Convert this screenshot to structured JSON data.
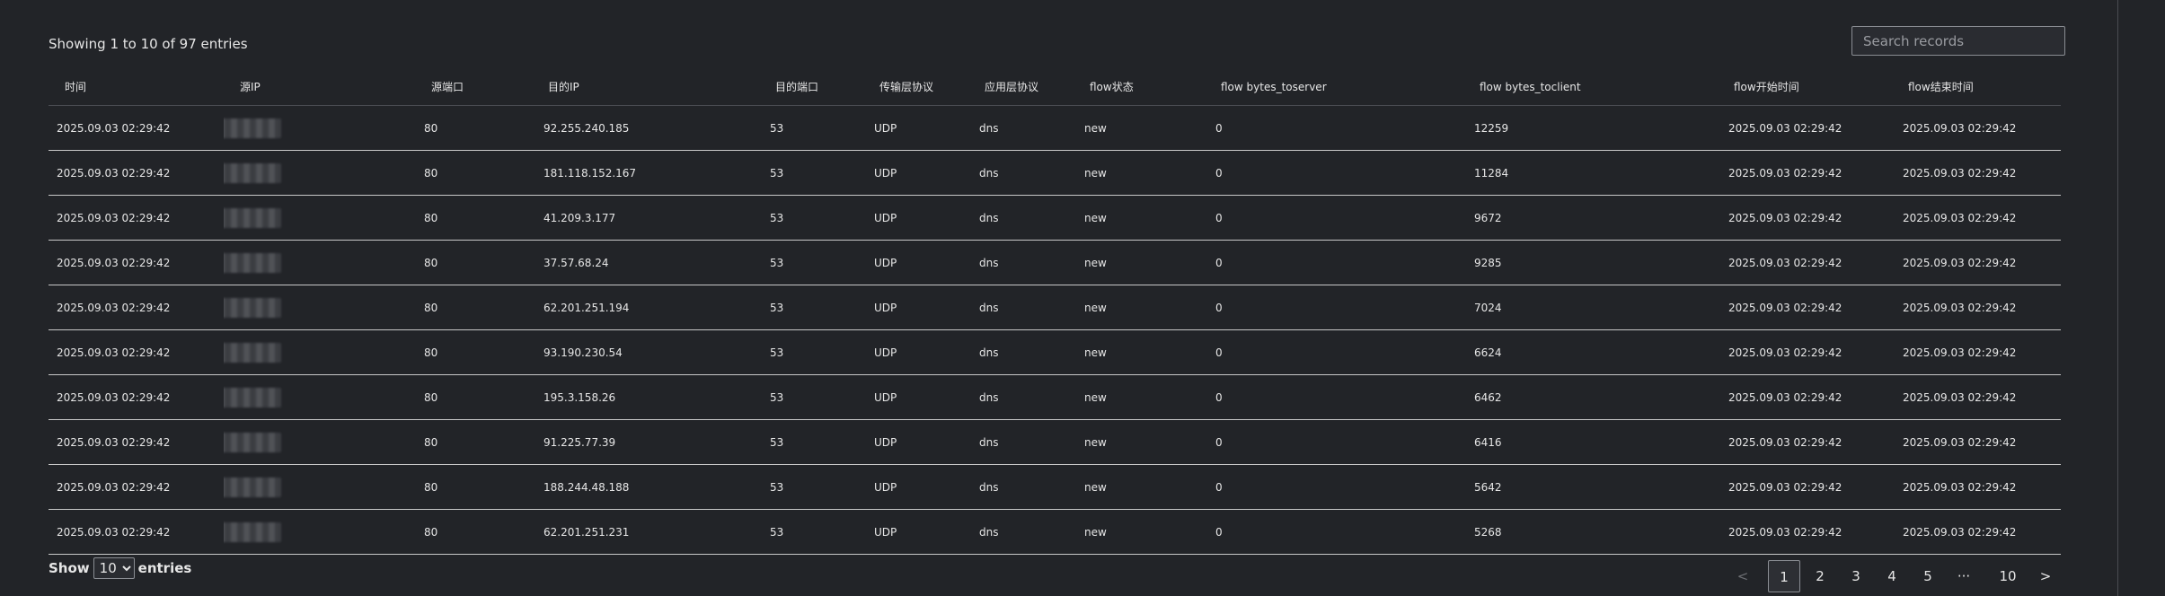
{
  "summary": "Showing 1 to 10 of 97 entries",
  "search": {
    "placeholder": "Search records"
  },
  "table": {
    "columns": [
      "时间",
      "源IP",
      "源端口",
      "目的IP",
      "目的端口",
      "传输层协议",
      "应用层协议",
      "flow状态",
      "flow bytes_toserver",
      "flow bytes_toclient",
      "flow开始时间",
      "flow结束时间"
    ],
    "rows": [
      [
        "2025.09.03 02:29:42",
        "",
        "80",
        "92.255.240.185",
        "53",
        "UDP",
        "dns",
        "new",
        "0",
        "12259",
        "2025.09.03 02:29:42",
        "2025.09.03 02:29:42"
      ],
      [
        "2025.09.03 02:29:42",
        "",
        "80",
        "181.118.152.167",
        "53",
        "UDP",
        "dns",
        "new",
        "0",
        "11284",
        "2025.09.03 02:29:42",
        "2025.09.03 02:29:42"
      ],
      [
        "2025.09.03 02:29:42",
        "",
        "80",
        "41.209.3.177",
        "53",
        "UDP",
        "dns",
        "new",
        "0",
        "9672",
        "2025.09.03 02:29:42",
        "2025.09.03 02:29:42"
      ],
      [
        "2025.09.03 02:29:42",
        "",
        "80",
        "37.57.68.24",
        "53",
        "UDP",
        "dns",
        "new",
        "0",
        "9285",
        "2025.09.03 02:29:42",
        "2025.09.03 02:29:42"
      ],
      [
        "2025.09.03 02:29:42",
        "",
        "80",
        "62.201.251.194",
        "53",
        "UDP",
        "dns",
        "new",
        "0",
        "7024",
        "2025.09.03 02:29:42",
        "2025.09.03 02:29:42"
      ],
      [
        "2025.09.03 02:29:42",
        "",
        "80",
        "93.190.230.54",
        "53",
        "UDP",
        "dns",
        "new",
        "0",
        "6624",
        "2025.09.03 02:29:42",
        "2025.09.03 02:29:42"
      ],
      [
        "2025.09.03 02:29:42",
        "",
        "80",
        "195.3.158.26",
        "53",
        "UDP",
        "dns",
        "new",
        "0",
        "6462",
        "2025.09.03 02:29:42",
        "2025.09.03 02:29:42"
      ],
      [
        "2025.09.03 02:29:42",
        "",
        "80",
        "91.225.77.39",
        "53",
        "UDP",
        "dns",
        "new",
        "0",
        "6416",
        "2025.09.03 02:29:42",
        "2025.09.03 02:29:42"
      ],
      [
        "2025.09.03 02:29:42",
        "",
        "80",
        "188.244.48.188",
        "53",
        "UDP",
        "dns",
        "new",
        "0",
        "5642",
        "2025.09.03 02:29:42",
        "2025.09.03 02:29:42"
      ],
      [
        "2025.09.03 02:29:42",
        "",
        "80",
        "62.201.251.231",
        "53",
        "UDP",
        "dns",
        "new",
        "0",
        "5268",
        "2025.09.03 02:29:42",
        "2025.09.03 02:29:42"
      ]
    ]
  },
  "footer": {
    "show_label": "Show",
    "entries_label": "entries",
    "page_size": "10",
    "page_size_options": [
      "10"
    ]
  },
  "pagination": {
    "prev": "<",
    "next": ">",
    "pages": [
      "1",
      "2",
      "3",
      "4",
      "5",
      "···",
      "10"
    ],
    "current": "1"
  },
  "colors": {
    "background": "#222428",
    "text": "#e6e6e6",
    "row_divider": "#c8c8c8"
  }
}
